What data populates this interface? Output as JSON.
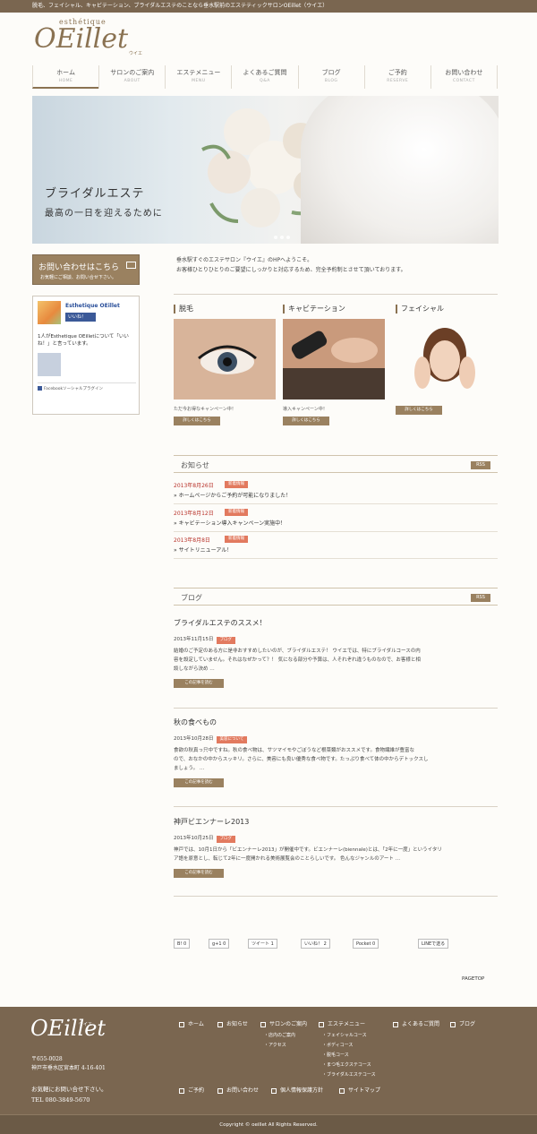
{
  "topbar": {
    "text": "脱毛、フェイシャル、キャビテーション、ブライダルエステのことなら垂水駅前のエステティックサロンOEillet（ウイエ）"
  },
  "logo": {
    "sub": "esthétique",
    "name": "OEillet",
    "kana": "ウイエ"
  },
  "nav": [
    {
      "jp": "ホーム",
      "en": "HOME"
    },
    {
      "jp": "サロンのご案内",
      "en": "ABOUT"
    },
    {
      "jp": "エステメニュー",
      "en": "MENU"
    },
    {
      "jp": "よくあるご質問",
      "en": "Q&A"
    },
    {
      "jp": "ブログ",
      "en": "BLOG"
    },
    {
      "jp": "ご予約",
      "en": "RESERVE"
    },
    {
      "jp": "お問い合わせ",
      "en": "CONTACT"
    }
  ],
  "hero": {
    "title": "ブライダルエステ",
    "subtitle": "最高の一日を迎えるために"
  },
  "contact_button": {
    "title": "お問い合わせはこちら",
    "sub": "お気軽にご相談、お問い合せ下さい。"
  },
  "facebook": {
    "page_name": "Esthetique OEillet",
    "like_label": "いいね！",
    "fans_text": "1人がEsthetique OEilletについて「いいね！」と言っています。",
    "plugin_label": "Facebookソーシャルプラグイン"
  },
  "intro": {
    "line1": "垂水駅すぐのエステサロン『ウイエ』のHPへようこそ。",
    "line2": "お客様ひとりひとりのご要望にしっかりと対応するため、完全予約制とさせて頂いております。"
  },
  "categories": [
    {
      "title": "脱毛",
      "caption": "ただ今お得なキャンペーン中！",
      "button": "詳しくはこちら"
    },
    {
      "title": "キャビテーション",
      "caption": "導入キャンペーン中！",
      "button": "詳しくはこちら"
    },
    {
      "title": "フェイシャル",
      "caption": "",
      "button": "詳しくはこちら"
    }
  ],
  "news": {
    "heading": "お知らせ",
    "rss": "RSS",
    "items": [
      {
        "date": "2013年8月26日",
        "tag": "新着情報",
        "text": "» ホームページからご予約が可能になりました！"
      },
      {
        "date": "2013年8月12日",
        "tag": "新着情報",
        "text": "» キャビテーション導入キャンペーン実施中！"
      },
      {
        "date": "2013年8月8日",
        "tag": "新着情報",
        "text": "» サイトリニューアル！"
      }
    ]
  },
  "blog": {
    "heading": "ブログ",
    "rss": "RSS",
    "posts": [
      {
        "title": "ブライダルエステのススメ！",
        "date": "2013年11月15日",
        "tag": "ブログ",
        "lines": [
          "結婚のご予定のある方に是非おすすめしたいのが、ブライダルエステ！ ウイエでは、特にブライダルコースの内",
          "容を設定していません。それはなぜかって？！ 気になる部分や予算は、人それぞれ違うものなので、お客様と相",
          "談しながら決め …"
        ],
        "button": "この記事を読む"
      },
      {
        "title": "秋の食べもの",
        "date": "2013年10月28日",
        "tag": "美容について",
        "lines": [
          "食欲の秋真っ只中ですね。秋の食べ物は、サツマイモやごぼうなど根菜類がおススメです。食物繊維が豊富な",
          "ので、おなかの中からスッキリ。さらに、美容にも良い優秀な食べ物です。たっぷり食べて体の中からデトックスし",
          "ましょう。 …"
        ],
        "button": "この記事を読む"
      },
      {
        "title": "神戸ビエンナーレ2013",
        "date": "2013年10月25日",
        "tag": "ブログ",
        "lines": [
          "神戸では、10月1日から「ビエンナーレ2013」が開催中です。ビエンナーレ(biennale)とは、「2年に一度」というイタリ",
          "ア語を原意とし、転じて2年に一度開かれる美術展覧会のことらしいです。 色んなジャンルのアート …"
        ],
        "button": "この記事を読む"
      }
    ]
  },
  "share": {
    "hatena": "B! 0",
    "gplus": "g+1 0",
    "tweet": "ツイート 1",
    "fb_like": "いいね！ 2",
    "pocket": "Pocket 0",
    "line": "LINEで送る"
  },
  "pagetop": "PAGETOP",
  "footer": {
    "logo": "OEillet",
    "kana": "ウイエ",
    "postal": "〒655-0028",
    "address": "神戸市垂水区宮本町 4-16-401",
    "contact": "お気軽にお問い合せ下さい。",
    "tel": "TEL 080-3849-5670",
    "links": {
      "home": "ホーム",
      "news": "お知らせ",
      "salon": "サロンのご案内",
      "menu": "エステメニュー",
      "faq": "よくあるご質問",
      "blog": "ブログ",
      "reserve": "ご予約",
      "contact": "お問い合わせ",
      "privacy": "個人情報保護方針",
      "sitemap": "サイトマップ"
    },
    "salon_sub": [
      "店内のご案内",
      "アクセス"
    ],
    "menu_sub": [
      "フェイシャルコース",
      "ボディコース",
      "脱毛コース",
      "まつ毛エクステコース",
      "ブライダルエステコース"
    ]
  },
  "copyright": "Copyright © oeillet All Rights Reserved."
}
